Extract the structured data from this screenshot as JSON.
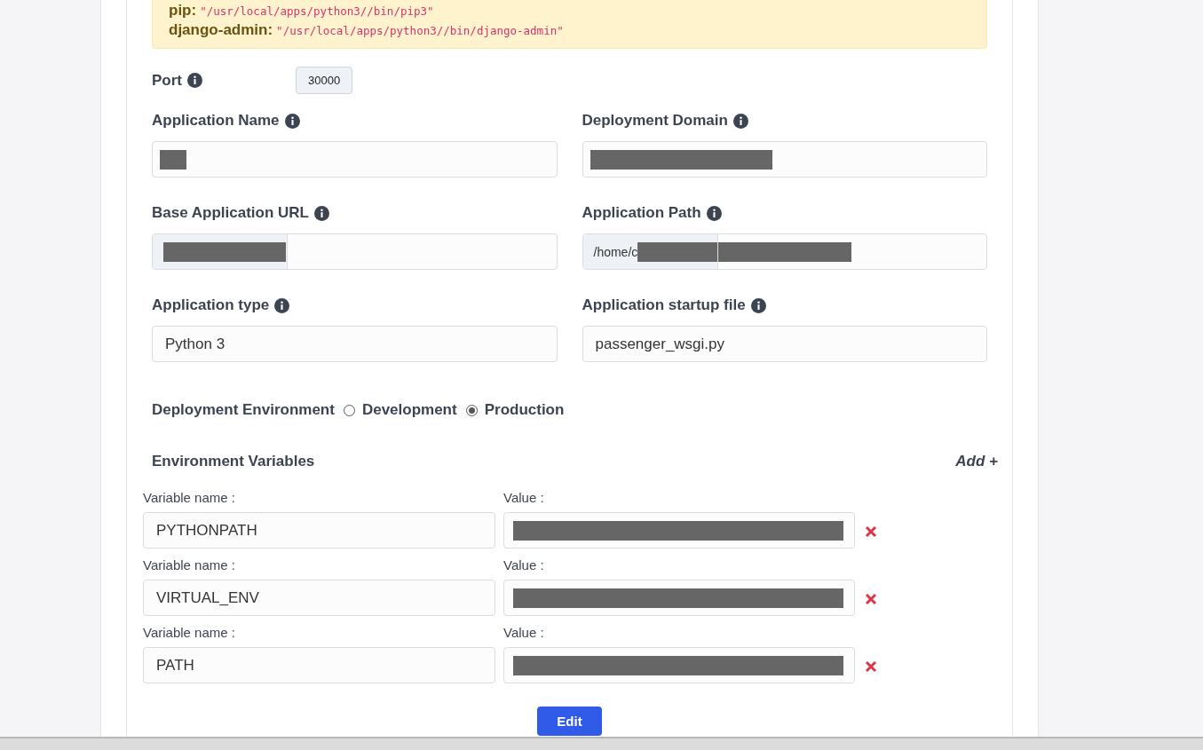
{
  "notice": {
    "lines": [
      {
        "label": "pip:",
        "value": "\"/usr/local/apps/python3//bin/pip3\""
      },
      {
        "label": "django-admin:",
        "value": "\"/usr/local/apps/python3//bin/django-admin\""
      }
    ]
  },
  "port": {
    "label": "Port",
    "value": "30000"
  },
  "fields": [
    {
      "label": "Application Name",
      "kind": "text",
      "redacted": true
    },
    {
      "label": "Deployment Domain",
      "kind": "text",
      "redacted": true
    },
    {
      "label": "Base Application URL",
      "kind": "prefixed",
      "prefix_redacted": true,
      "redacted": false
    },
    {
      "label": "Application Path",
      "kind": "prefixed",
      "prefix": "/home/c",
      "prefix_redacted": true,
      "redacted": true
    },
    {
      "label": "Application type",
      "kind": "text",
      "value": "Python 3",
      "redacted": false
    },
    {
      "label": "Application startup file",
      "kind": "text",
      "value": "passenger_wsgi.py",
      "redacted": false
    }
  ],
  "deployment": {
    "label": "Deployment Environment",
    "options": [
      {
        "label": "Development",
        "selected": false
      },
      {
        "label": "Production",
        "selected": true
      }
    ]
  },
  "env": {
    "title": "Environment Variables",
    "add": "Add +",
    "variables": [
      {
        "name_label": "Variable name :",
        "name": "PYTHONPATH",
        "value_label": "Value :",
        "redacted": true
      },
      {
        "name_label": "Variable name :",
        "name": "VIRTUAL_ENV",
        "value_label": "Value :",
        "redacted": true
      },
      {
        "name_label": "Variable name :",
        "name": "PATH",
        "value_label": "Value :",
        "redacted": true
      }
    ]
  },
  "submit": "Edit"
}
